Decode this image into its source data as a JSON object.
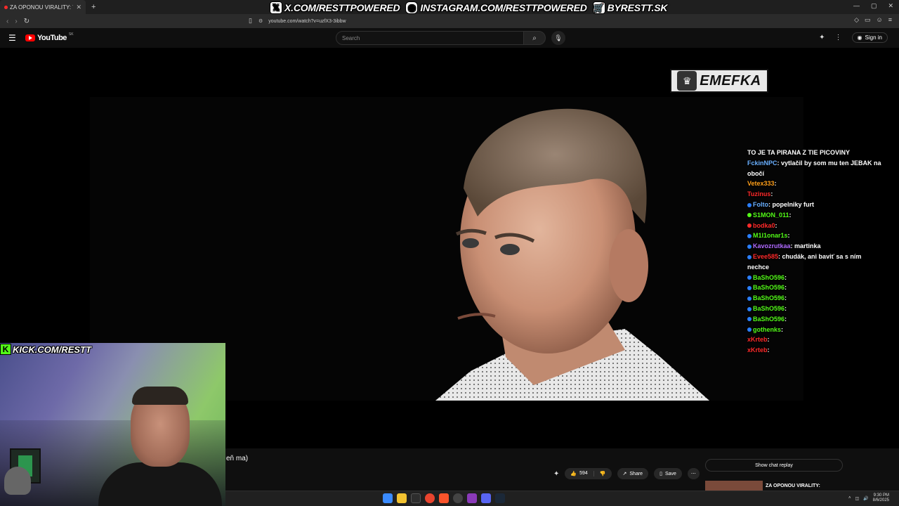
{
  "browser": {
    "tab_title": "ZA OPONOU VIRALITY: TIBO",
    "url": "youtube.com/watch?v=uzfX3-3ibbw"
  },
  "overlay": {
    "x_handle": "X.COM/RESTTPOWERED",
    "instagram_handle": "INSTAGRAM.COM/RESTTPOWERED",
    "shop_handle": "BYRESTT.SK",
    "kick_handle": "KICK.COM/RESTT",
    "emefka_logo": "EMEFKA"
  },
  "youtube": {
    "logo_text": "YouTube",
    "region": "SK",
    "search_placeholder": "Search",
    "sign_in": "Sign in",
    "partial_title": "eň ma)",
    "likes": "594",
    "share_label": "Share",
    "save_label": "Save",
    "show_chat_replay": "Show chat replay",
    "rec_title": "ZA OPONOU VIRALITY:"
  },
  "chat": [
    {
      "user": "TO JE TA PIRANA Z TIE PICOVINY",
      "msg": "",
      "color": "#ffffff",
      "badge": ""
    },
    {
      "user": "FckinNPC",
      "msg": "vytlačil by som mu ten JEBAK na",
      "color": "#6ab0ff",
      "badge": ""
    },
    {
      "user": "",
      "msg": "obočí",
      "color": "#ffffff",
      "badge": ""
    },
    {
      "user": "Vetex333",
      "msg": "",
      "color": "#ff9f1a",
      "badge": ""
    },
    {
      "user": "Tuzinus",
      "msg": "",
      "color": "#ff2a2a",
      "badge": ""
    },
    {
      "user": "Folto",
      "msg": "popelniky furt",
      "color": "#6ab0ff",
      "badge": "#2a7fff"
    },
    {
      "user": "S1MON_011",
      "msg": "",
      "color": "#53fc18",
      "badge": "#53fc18"
    },
    {
      "user": "bodka0",
      "msg": "",
      "color": "#ff2a2a",
      "badge": "#ff2a2a"
    },
    {
      "user": "M1l1onar1s",
      "msg": "",
      "color": "#53fc18",
      "badge": "#2a7fff"
    },
    {
      "user": "Kavozrutkaa",
      "msg": "martinka",
      "color": "#b06aff",
      "badge": "#2a7fff"
    },
    {
      "user": "Evee585",
      "msg": "chudák, ani baviť sa s ním",
      "color": "#ff2a2a",
      "badge": "#2a7fff"
    },
    {
      "user": "",
      "msg": "nechce",
      "color": "#ffffff",
      "badge": ""
    },
    {
      "user": "BaShO596",
      "msg": "",
      "color": "#53fc18",
      "badge": "#2a7fff"
    },
    {
      "user": "BaShO596",
      "msg": "",
      "color": "#53fc18",
      "badge": "#2a7fff"
    },
    {
      "user": "BaShO596",
      "msg": "",
      "color": "#53fc18",
      "badge": "#2a7fff"
    },
    {
      "user": "BaShO596",
      "msg": "",
      "color": "#53fc18",
      "badge": "#2a7fff"
    },
    {
      "user": "BaShO596",
      "msg": "",
      "color": "#53fc18",
      "badge": "#2a7fff"
    },
    {
      "user": "gothenks",
      "msg": "",
      "color": "#53fc18",
      "badge": "#2a7fff"
    },
    {
      "user": "xKrteb",
      "msg": "",
      "color": "#ff2a2a",
      "badge": ""
    },
    {
      "user": "xKrteb",
      "msg": "",
      "color": "#ff2a2a",
      "badge": ""
    }
  ],
  "taskbar": {
    "time": "9:30 PM",
    "date": "8/6/2025"
  },
  "colors": {
    "kick_green": "#53fc18",
    "youtube_red": "#ff0000"
  }
}
